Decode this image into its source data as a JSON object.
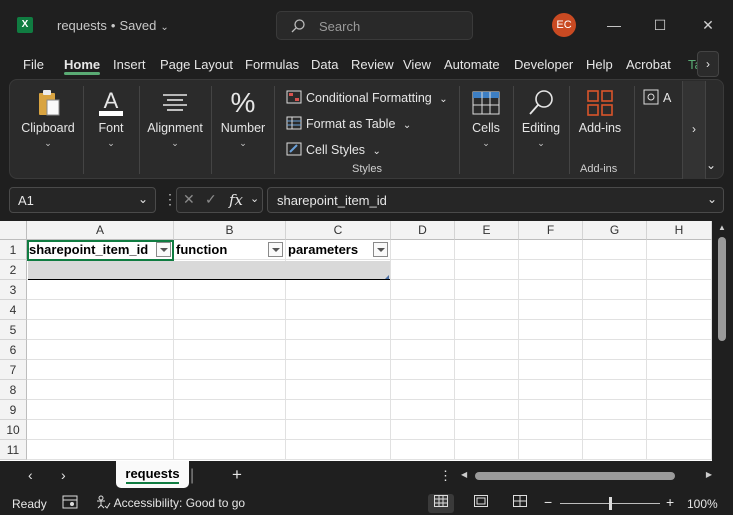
{
  "window": {
    "app_icon": "excel-icon",
    "title": "requests",
    "separator": "•",
    "save_status": "Saved",
    "search_placeholder": "Search",
    "avatar_initials": "EC",
    "avatar_color": "#c94a22"
  },
  "ribbon_tabs": [
    "File",
    "Home",
    "Insert",
    "Page Layout",
    "Formulas",
    "Data",
    "Review",
    "View",
    "Automate",
    "Developer",
    "Help",
    "Acrobat",
    "Ta"
  ],
  "active_tab": "Home",
  "ribbon": {
    "clipboard": "Clipboard",
    "font": "Font",
    "alignment": "Alignment",
    "number": "Number",
    "conditional_formatting": "Conditional Formatting",
    "format_as_table": "Format as Table",
    "cell_styles": "Cell Styles",
    "styles_group": "Styles",
    "cells": "Cells",
    "editing": "Editing",
    "addins": "Add-ins",
    "addins_group": "Add-ins",
    "partial": "A"
  },
  "formula_bar": {
    "name_box": "A1",
    "formula": "sharepoint_item_id",
    "fx": "fx"
  },
  "grid": {
    "columns": [
      "A",
      "B",
      "C",
      "D",
      "E",
      "F",
      "G",
      "H"
    ],
    "rows": [
      "1",
      "2",
      "3",
      "4",
      "5",
      "6",
      "7",
      "8",
      "9",
      "10",
      "11"
    ],
    "headers": [
      "sharepoint_item_id",
      "function",
      "parameters"
    ]
  },
  "sheets": {
    "active": "requests",
    "add": "+"
  },
  "status": {
    "ready": "Ready",
    "accessibility": "Accessibility: Good to go",
    "zoom": "100%",
    "zoom_level": 1.0,
    "minus": "−",
    "plus": "+"
  },
  "colors": {
    "excel_green": "#107c41",
    "tab_underline": "#5aab74"
  }
}
